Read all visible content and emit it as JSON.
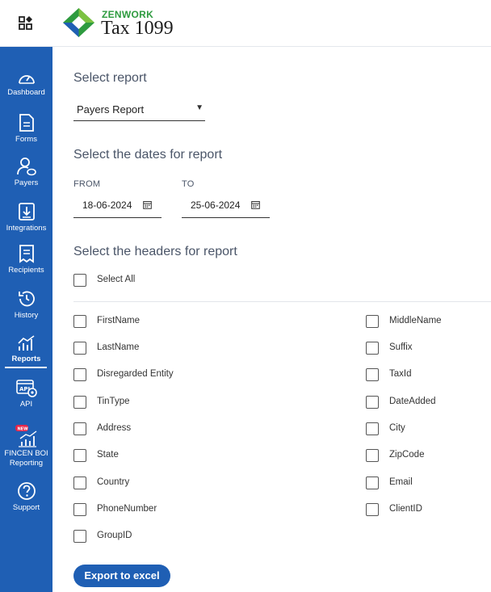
{
  "header": {
    "brand": "ZENWORK",
    "product": "Tax 1099"
  },
  "sidebar": {
    "items": [
      {
        "label": "Dashboard",
        "icon": "dashboard-icon"
      },
      {
        "label": "Forms",
        "icon": "forms-icon"
      },
      {
        "label": "Payers",
        "icon": "payers-icon"
      },
      {
        "label": "Integrations",
        "icon": "integrations-icon"
      },
      {
        "label": "Recipients",
        "icon": "recipients-icon"
      },
      {
        "label": "History",
        "icon": "history-icon"
      },
      {
        "label": "Reports",
        "icon": "reports-icon",
        "active": true
      },
      {
        "label": "API",
        "icon": "api-icon"
      },
      {
        "label": "FINCEN BOI Reporting",
        "line1": "FINCEN BOI",
        "line2": "Reporting",
        "icon": "fincen-icon",
        "badge": "NEW"
      },
      {
        "label": "Support",
        "icon": "support-icon"
      }
    ]
  },
  "report": {
    "select_title": "Select report",
    "selected_report": "Payers Report",
    "dates_title": "Select the dates for report",
    "from_label": "FROM",
    "from_value": "18-06-2024",
    "to_label": "TO",
    "to_value": "25-06-2024",
    "headers_title": "Select the headers for report",
    "select_all": "Select All",
    "export_label": "Export to excel"
  },
  "headers_left": [
    "FirstName",
    "LastName",
    "Disregarded Entity",
    "TinType",
    "Address",
    "State",
    "Country",
    "PhoneNumber",
    "GroupID"
  ],
  "headers_right": [
    "MiddleName",
    "Suffix",
    "TaxId",
    "DateAdded",
    "City",
    "ZipCode",
    "Email",
    "ClientID"
  ],
  "colors": {
    "sidebar": "#1f5fb4",
    "accent": "#1f5fb4",
    "brand_green": "#2e9b3f"
  }
}
